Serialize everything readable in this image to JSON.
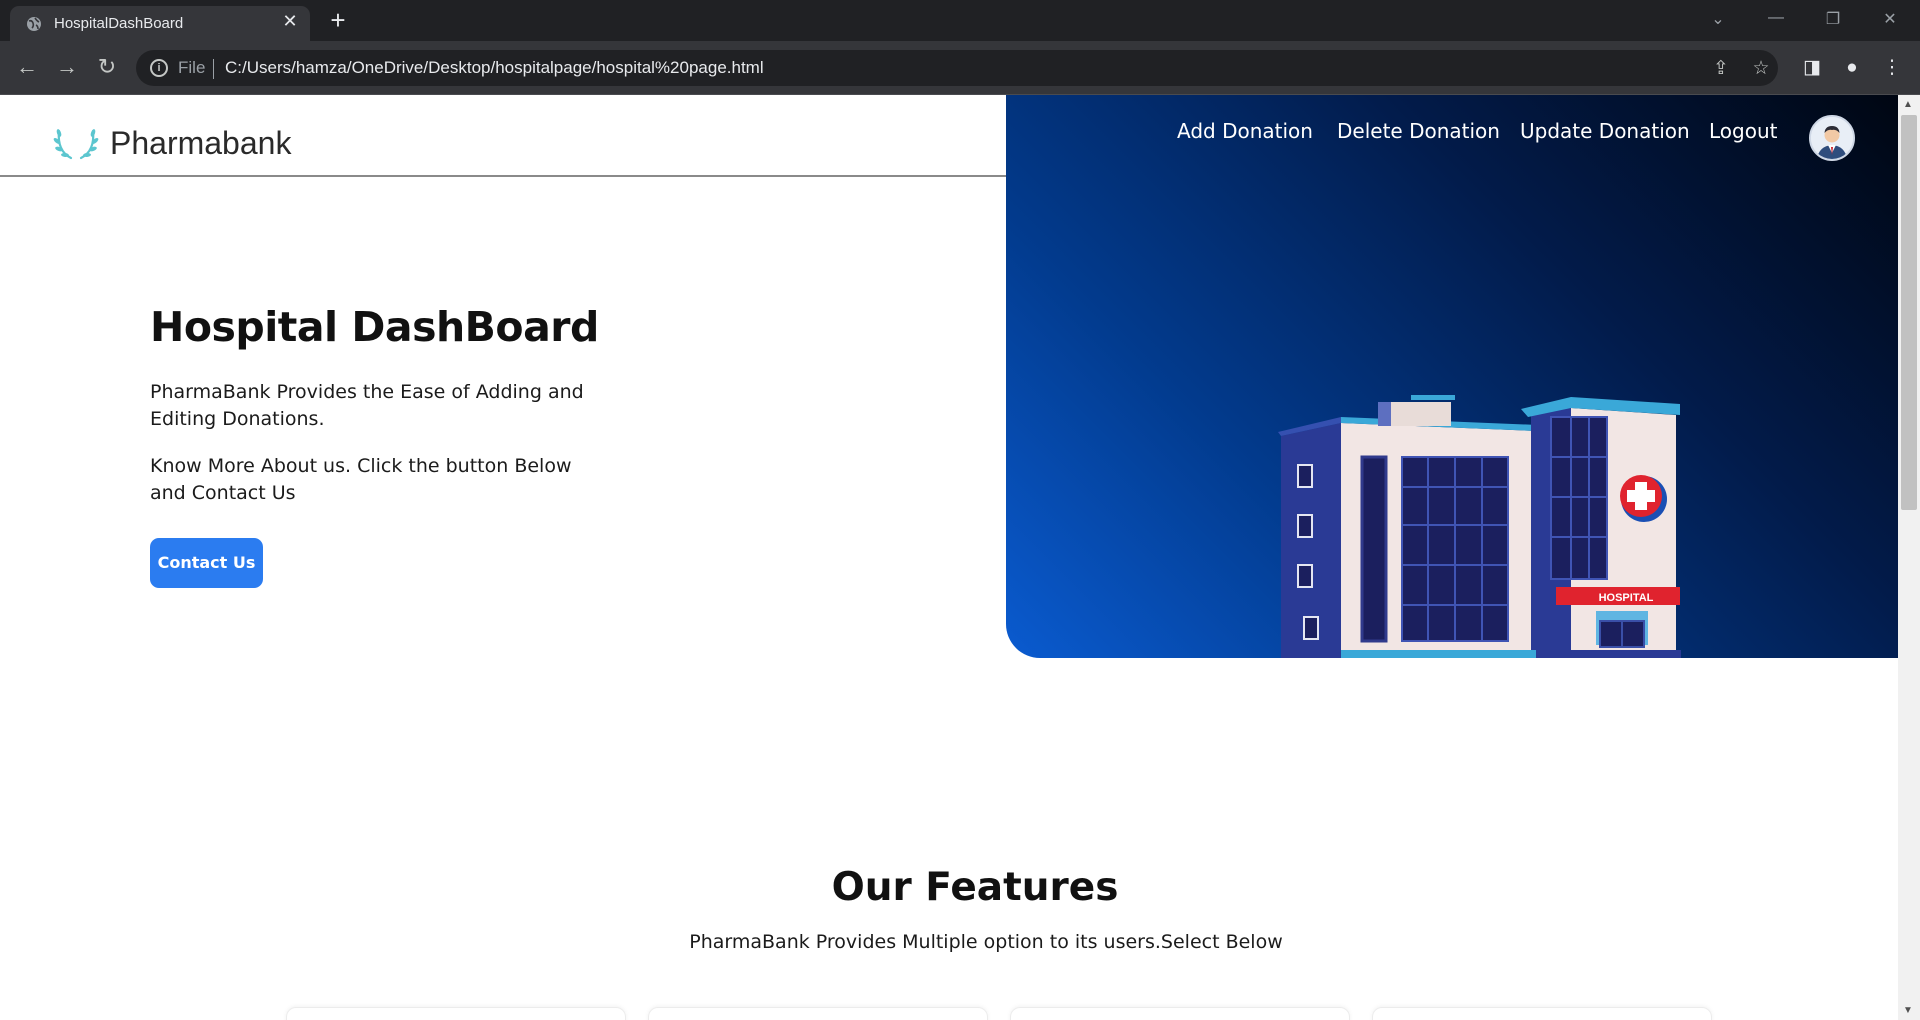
{
  "browser": {
    "tab_title": "HospitalDashBoard",
    "tab_close": "✕",
    "new_tab": "+",
    "omnibox_scheme": "File",
    "omnibox_url": "C:/Users/hamza/OneDrive/Desktop/hospitalpage/hospital%20page.html",
    "icons": [
      "back-icon",
      "forward-icon",
      "reload-icon",
      "info-icon",
      "share-icon",
      "star-icon",
      "sidepanel-icon",
      "profile-icon",
      "menu-icon"
    ]
  },
  "brand": {
    "name": "Pharmabank"
  },
  "nav": {
    "items": [
      "Add Donation",
      "Delete Donation",
      "Update Donation",
      "Logout"
    ]
  },
  "hero": {
    "title": "Hospital DashBoard",
    "p1": "PharmaBank Provides the Ease of Adding and Editing Donations.",
    "p2": "Know More About us. Click the button Below and Contact Us",
    "button": "Contact Us",
    "illustration_sign": "HOSPITAL"
  },
  "features": {
    "title": "Our Features",
    "subtitle": "PharmaBank Provides Multiple option to its users.Select Below"
  },
  "colors": {
    "accent": "#2b7cf0",
    "hero_dark": "#000612",
    "hero_blue": "#0a5bd0",
    "chrome_dark": "#202124"
  }
}
